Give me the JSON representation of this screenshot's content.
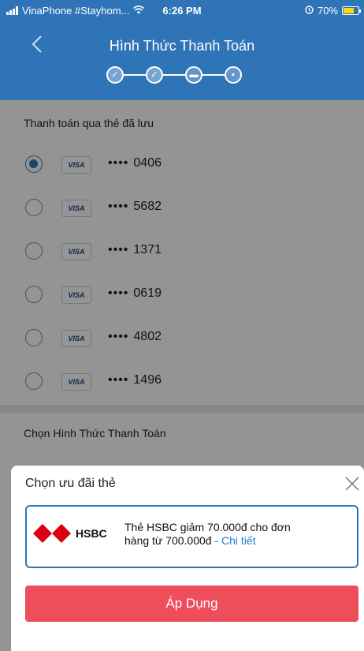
{
  "status_bar": {
    "carrier": "VinaPhone #Stayhom...",
    "time": "6:26 PM",
    "battery": "70%",
    "wifi_icon": "wifi-icon",
    "battery_level": 0.7
  },
  "header": {
    "title": "Hình Thức Thanh Toán",
    "back_icon": "chevron-left-icon",
    "steps": [
      {
        "icon": "check-icon",
        "symbol": "✓"
      },
      {
        "icon": "check-icon",
        "symbol": "✓"
      },
      {
        "icon": "card-icon",
        "symbol": "▬"
      },
      {
        "icon": "lock-icon",
        "symbol": "▪"
      }
    ]
  },
  "saved_cards": {
    "label": "Thanh toán qua thẻ đã lưu",
    "brand_label": "VISA",
    "mask": "••••",
    "cards": [
      {
        "last4": "0406",
        "selected": true
      },
      {
        "last4": "5682",
        "selected": false
      },
      {
        "last4": "1371",
        "selected": false
      },
      {
        "last4": "0619",
        "selected": false
      },
      {
        "last4": "4802",
        "selected": false
      },
      {
        "last4": "1496",
        "selected": false
      }
    ]
  },
  "payment_method": {
    "label": "Chọn Hình Thức Thanh Toán"
  },
  "sheet": {
    "title": "Chọn ưu đãi thẻ",
    "close_icon": "close-icon",
    "offer": {
      "bank": "HSBC",
      "text_line1": "Thẻ HSBC giảm 70.000đ cho đơn",
      "text_line2": "hàng từ 700.000đ",
      "separator": " - ",
      "link": "Chi tiết"
    },
    "apply_label": "Áp Dụng",
    "colors": {
      "accent": "#2f74b7",
      "apply_button": "#ee4d5b",
      "link": "#1a7ed8"
    }
  }
}
